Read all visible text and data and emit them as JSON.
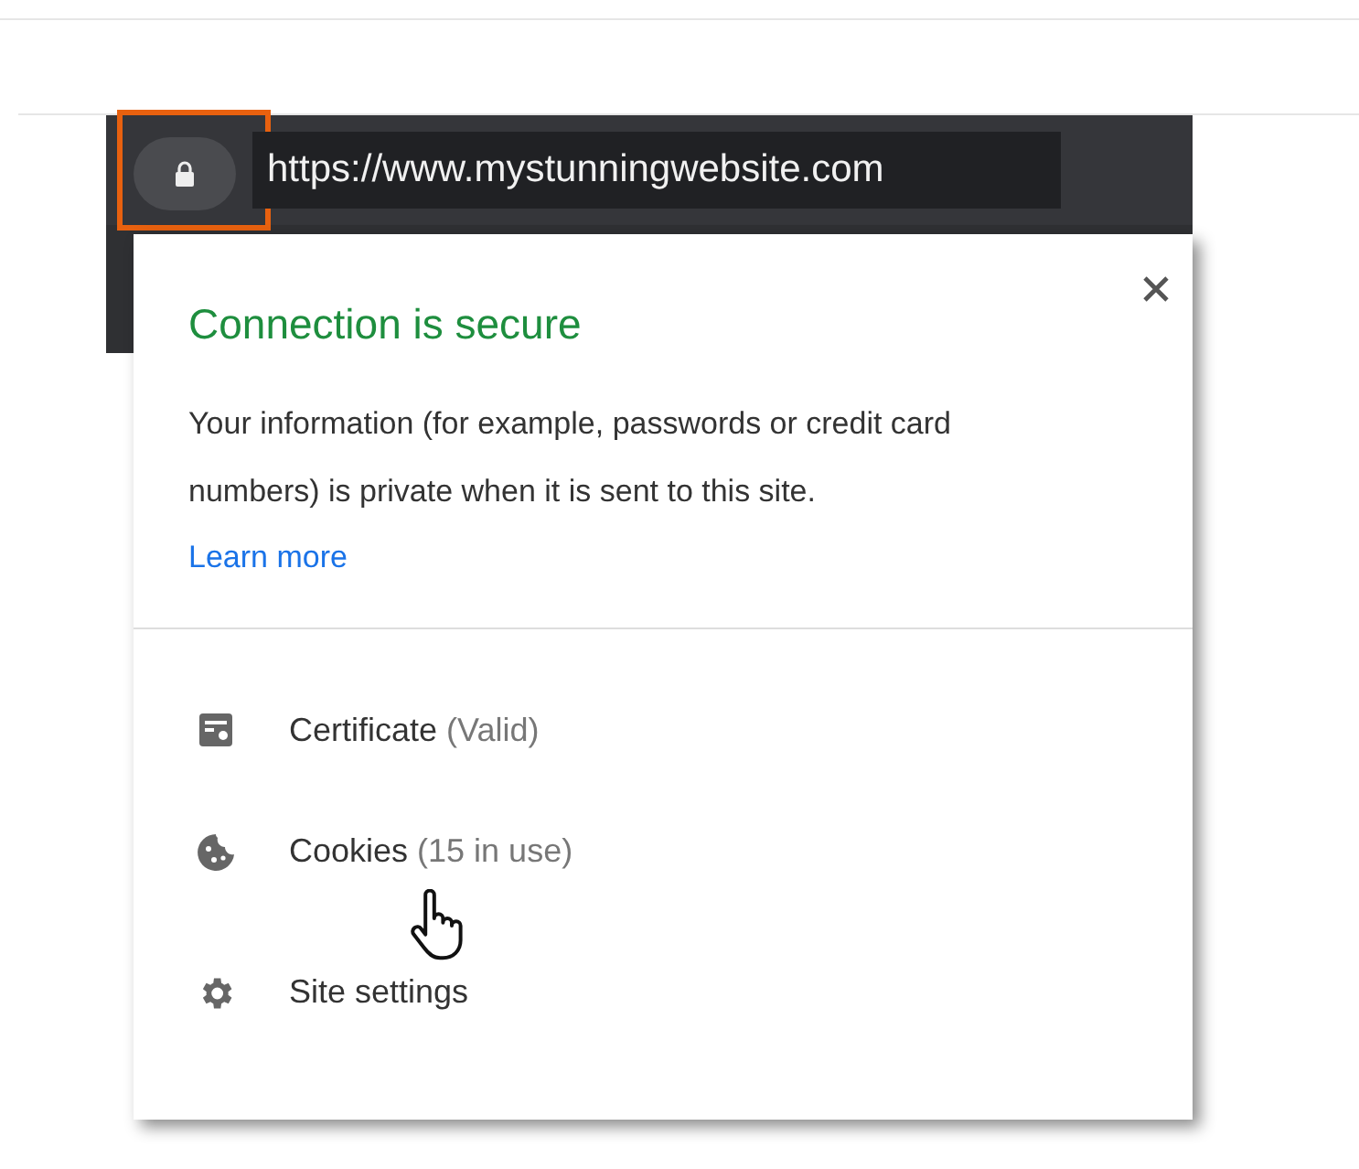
{
  "address_bar": {
    "url": "https://www.mystunningwebsite.com",
    "highlighted": true
  },
  "popup": {
    "title": "Connection is secure",
    "description": "Your information (for example, passwords or credit card numbers) is private when it is sent to this site.",
    "link": "Learn more",
    "items": [
      {
        "kind": "certificate",
        "label": "Certificate",
        "detail": "(Valid)"
      },
      {
        "kind": "cookies",
        "label": "Cookies",
        "detail": "(15 in use)"
      },
      {
        "kind": "settings",
        "label": "Site settings"
      }
    ]
  }
}
